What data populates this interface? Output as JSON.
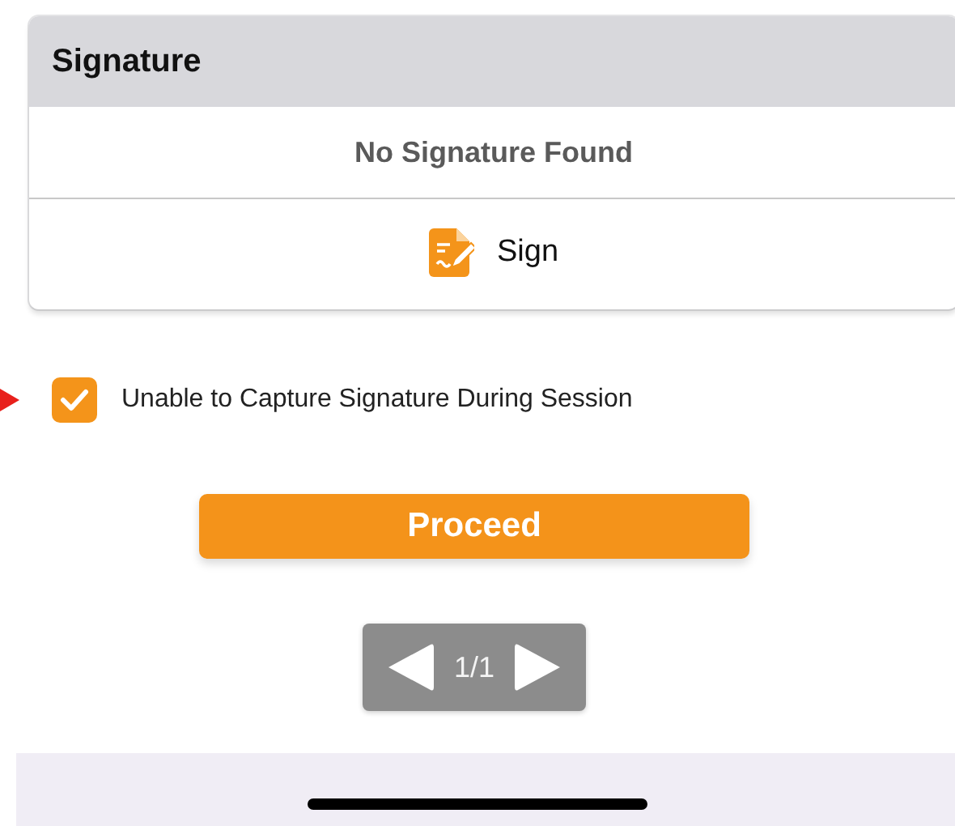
{
  "card": {
    "title": "Signature",
    "status": "No Signature Found",
    "sign_button": "Sign"
  },
  "unable_checkbox": {
    "label": "Unable to Capture Signature During Session",
    "checked": true
  },
  "proceed_button": "Proceed",
  "pager": {
    "page": "1/1"
  }
}
